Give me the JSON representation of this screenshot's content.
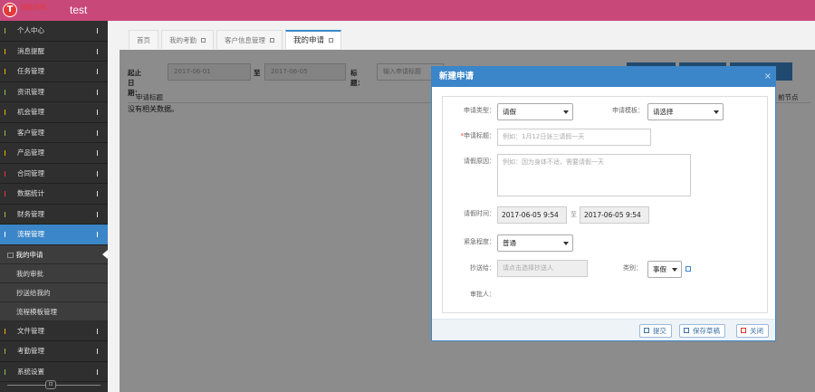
{
  "header": {
    "logo_letter": "T",
    "logo_text": "智能协同",
    "app_title": "test"
  },
  "sidebar": {
    "items": [
      {
        "label": "个人中心",
        "bar_color": "#8ec04b"
      },
      {
        "label": "消息提醒",
        "bar_color": "#f0b400"
      },
      {
        "label": "任务管理",
        "bar_color": "#f0b400"
      },
      {
        "label": "资讯管理",
        "bar_color": "#8ec04b"
      },
      {
        "label": "机会管理",
        "bar_color": "#f0b400"
      },
      {
        "label": "客户管理",
        "bar_color": "#8ec04b"
      },
      {
        "label": "产品管理",
        "bar_color": "#f0b400"
      },
      {
        "label": "合同管理",
        "bar_color": "#e5393a"
      },
      {
        "label": "数据统计",
        "bar_color": "#e5393a"
      },
      {
        "label": "财务管理",
        "bar_color": "#8ec04b"
      },
      {
        "label": "流程管理",
        "bar_color": "#ffffff"
      }
    ],
    "sub_items": [
      {
        "label": "我的申请",
        "marker": "□"
      },
      {
        "label": "我的审批"
      },
      {
        "label": "抄送给我的"
      },
      {
        "label": "流程模板管理"
      }
    ],
    "bottom_items": [
      {
        "label": "文件管理",
        "bar_color": "#f0b400"
      },
      {
        "label": "考勤管理",
        "bar_color": "#8ec04b"
      },
      {
        "label": "系统设置",
        "bar_color": "#8ec04b"
      }
    ],
    "collapse_glyph": "⊡"
  },
  "tabs": [
    {
      "label": "首页"
    },
    {
      "label": "我的考勤",
      "closable": true
    },
    {
      "label": "客户信息管理",
      "closable": true
    },
    {
      "label": "我的申请",
      "closable": true
    }
  ],
  "filter": {
    "start_label": "起止日期：",
    "start_value": "2017-06-01",
    "to_label": "至",
    "end_value": "2017-06-05",
    "title_label": "标题：",
    "title_placeholder": "输入申请标题"
  },
  "grid": {
    "col_title": "申请标题",
    "col_node": "前节点",
    "empty_text": "没有相关数据。"
  },
  "modal": {
    "title": "新建申请",
    "close_glyph": "×",
    "type_label": "申请类型：",
    "type_value": "请假",
    "template_label": "申请模板：",
    "template_value": "请选择",
    "title_field_label": "申请标题：",
    "title_required": "*",
    "title_placeholder": "例如：1月12日张三请假一天",
    "reason_label": "请假原因：",
    "reason_placeholder": "例如：因为身体不适，需要请假一天",
    "time_label": "请假时间：",
    "time_start": "2017-06-05 9:54",
    "time_to": "至",
    "time_end": "2017-06-05 9:54",
    "urgency_label": "紧急程度：",
    "urgency_value": "普通",
    "cc_label": "抄送给：",
    "cc_placeholder": "请点击选择抄送人",
    "category_label": "类别：",
    "category_value": "事假",
    "approver_label": "审批人：",
    "btn_submit": "提交",
    "btn_draft": "保存草稿",
    "btn_close": "关闭"
  }
}
